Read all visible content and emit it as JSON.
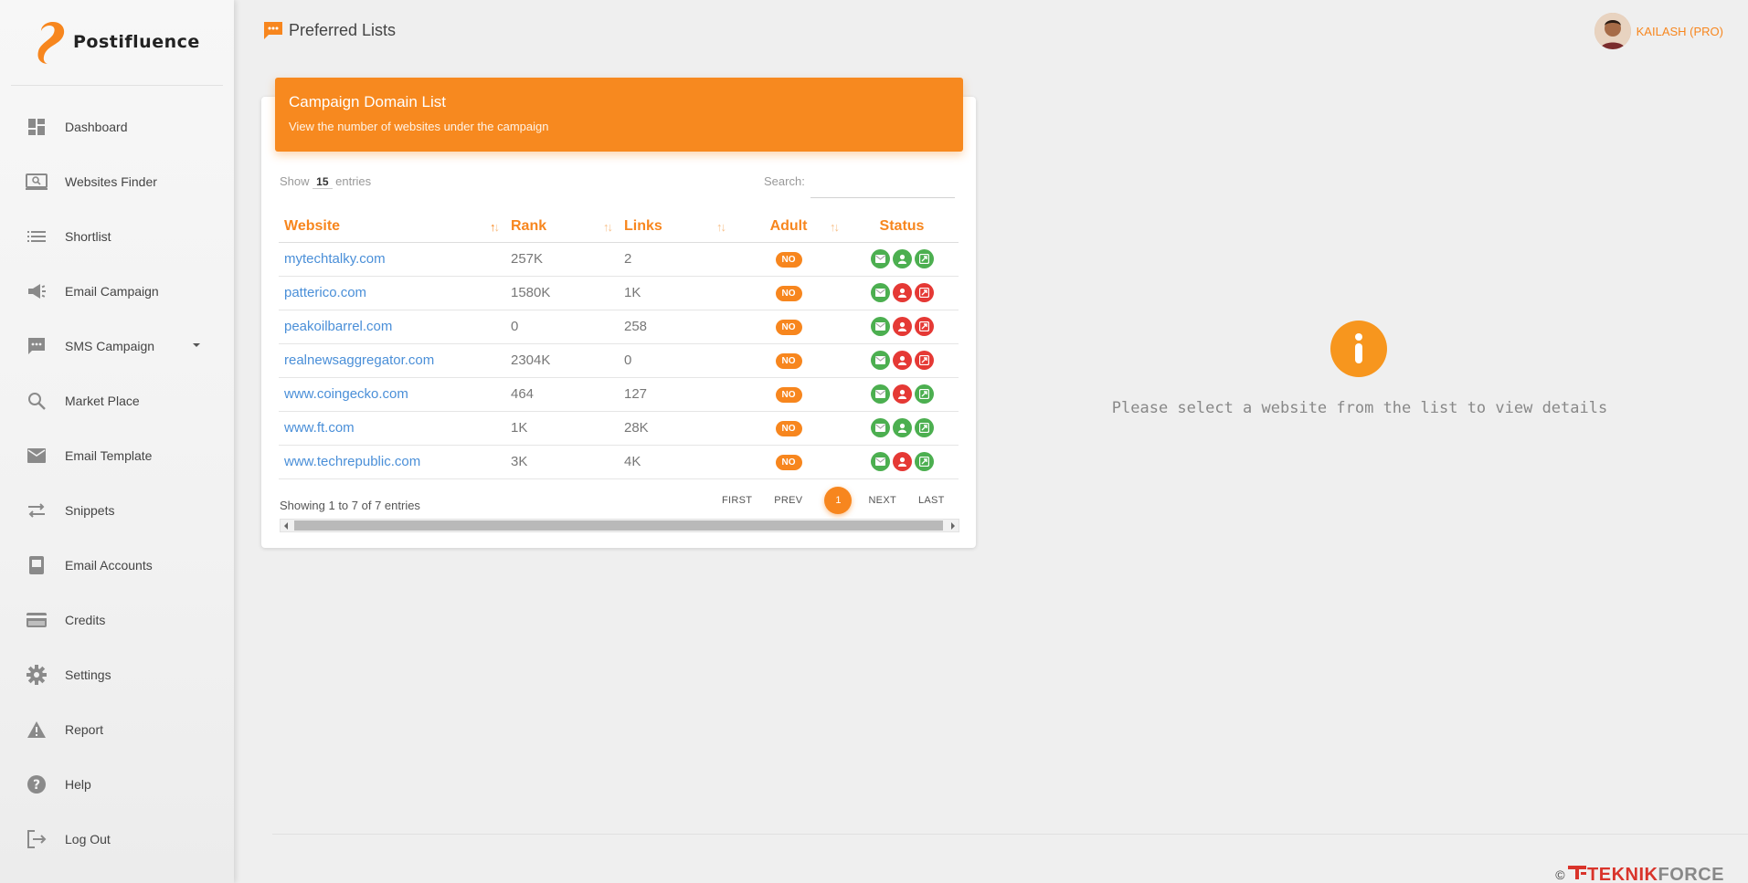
{
  "app": {
    "name": "Postifluence",
    "brand_color": "#f7861e"
  },
  "sidebar": {
    "items": [
      {
        "label": "Dashboard",
        "icon": "dashboard-icon"
      },
      {
        "label": "Websites Finder",
        "icon": "websites-finder-icon"
      },
      {
        "label": "Shortlist",
        "icon": "list-icon"
      },
      {
        "label": "Email Campaign",
        "icon": "megaphone-icon"
      },
      {
        "label": "SMS Campaign",
        "icon": "sms-icon"
      },
      {
        "label": "Market Place",
        "icon": "search-icon"
      },
      {
        "label": "Email Template",
        "icon": "mail-icon"
      },
      {
        "label": "Snippets",
        "icon": "swap-icon"
      },
      {
        "label": "Email Accounts",
        "icon": "mailbox-icon"
      },
      {
        "label": "Credits",
        "icon": "credit-card-icon"
      },
      {
        "label": "Settings",
        "icon": "gear-icon"
      },
      {
        "label": "Report",
        "icon": "warning-icon"
      },
      {
        "label": "Help",
        "icon": "help-icon"
      },
      {
        "label": "Log Out",
        "icon": "logout-icon"
      }
    ]
  },
  "header": {
    "title": "Preferred Lists",
    "user": "KAILASH (PRO)"
  },
  "card": {
    "title": "Campaign Domain List",
    "subtitle": "View the number of websites under the campaign",
    "show_prefix": "Show",
    "page_length": "15",
    "show_suffix": "entries",
    "search_label": "Search:",
    "search_value": "",
    "columns": [
      "Website",
      "Rank",
      "Links",
      "Adult",
      "Status"
    ],
    "rows": [
      {
        "website": "mytechtalky.com",
        "rank": "257K",
        "links": "2",
        "adult": "NO",
        "status": [
          "green",
          "green",
          "green"
        ]
      },
      {
        "website": "patterico.com",
        "rank": "1580K",
        "links": "1K",
        "adult": "NO",
        "status": [
          "green",
          "red",
          "red"
        ]
      },
      {
        "website": "peakoilbarrel.com",
        "rank": "0",
        "links": "258",
        "adult": "NO",
        "status": [
          "green",
          "red",
          "red"
        ]
      },
      {
        "website": "realnewsaggregator.com",
        "rank": "2304K",
        "links": "0",
        "adult": "NO",
        "status": [
          "green",
          "red",
          "red"
        ]
      },
      {
        "website": "www.coingecko.com",
        "rank": "464",
        "links": "127",
        "adult": "NO",
        "status": [
          "green",
          "red",
          "green"
        ]
      },
      {
        "website": "www.ft.com",
        "rank": "1K",
        "links": "28K",
        "adult": "NO",
        "status": [
          "green",
          "green",
          "green"
        ]
      },
      {
        "website": "www.techrepublic.com",
        "rank": "3K",
        "links": "4K",
        "adult": "NO",
        "status": [
          "green",
          "red",
          "green"
        ]
      }
    ],
    "info": "Showing 1 to 7 of 7 entries",
    "pager": {
      "first": "FIRST",
      "prev": "PREV",
      "current": "1",
      "next": "NEXT",
      "last": "LAST"
    }
  },
  "detail_panel": {
    "message": "Please select a website from the list to view details"
  },
  "footer": {
    "copyright": "©",
    "brand_part1": "TEKNIK",
    "brand_part2": "FORCE"
  }
}
